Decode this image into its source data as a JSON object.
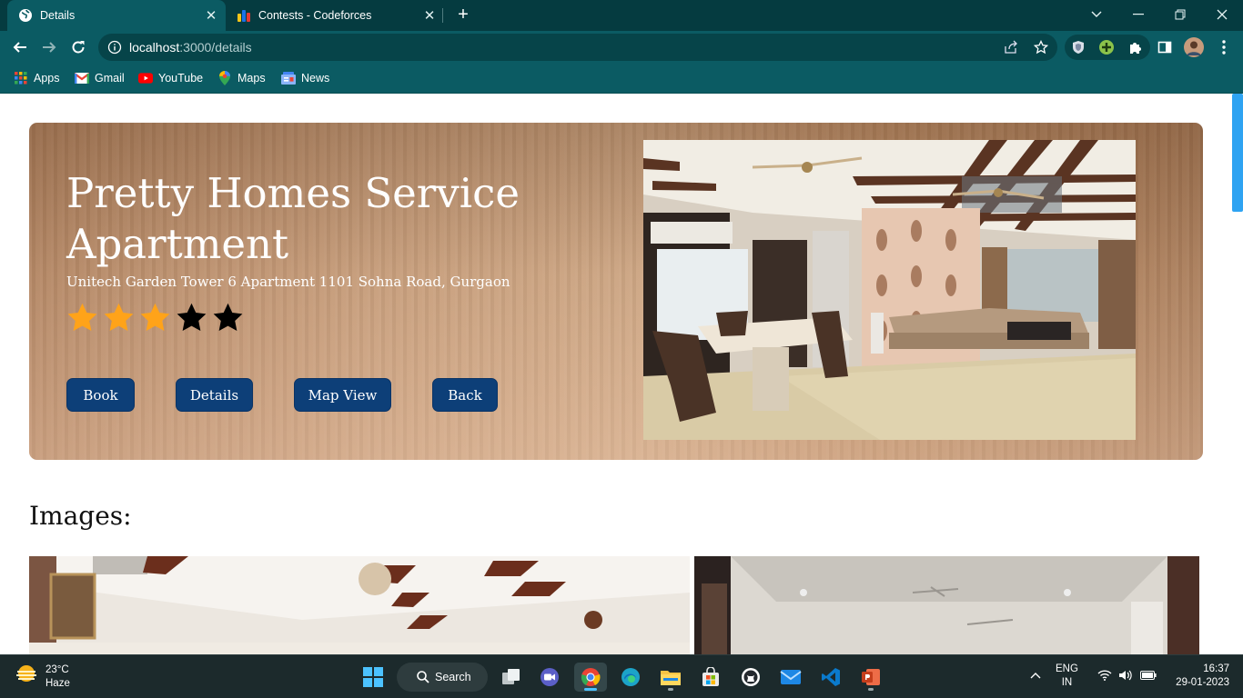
{
  "browser": {
    "tabs": [
      {
        "title": "Details",
        "active": true
      },
      {
        "title": "Contests - Codeforces",
        "active": false
      }
    ],
    "address": {
      "host": "localhost",
      "path": ":3000/details"
    },
    "bookmarks": [
      "Apps",
      "Gmail",
      "YouTube",
      "Maps",
      "News"
    ]
  },
  "hero": {
    "title": "Pretty Homes Service Apartment",
    "address": "Unitech Garden Tower 6 Apartment 1101 Sohna Road, Gurgaon",
    "rating": 3,
    "rating_max": 5,
    "buttons": {
      "book": "Book",
      "details": "Details",
      "map_view": "Map View",
      "back": "Back"
    },
    "colors": {
      "button": "#0d3f78",
      "star_filled": "#ffa319",
      "star_empty": "#000000"
    }
  },
  "images_heading": "Images:",
  "taskbar": {
    "weather": {
      "temp": "23°C",
      "condition": "Haze"
    },
    "search_label": "Search",
    "language": {
      "line1": "ENG",
      "line2": "IN"
    },
    "time": "16:37",
    "date": "29-01-2023"
  }
}
